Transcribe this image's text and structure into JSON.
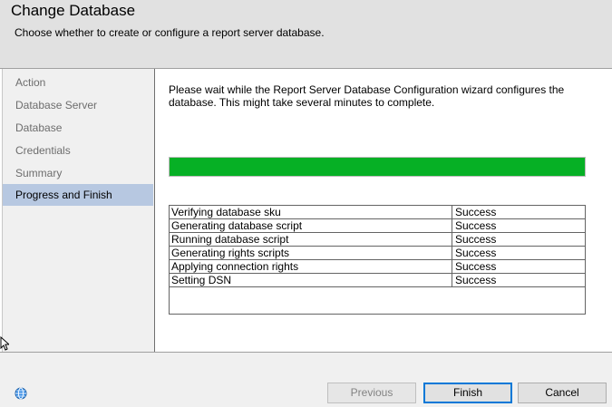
{
  "header": {
    "title": "Change Database",
    "subtitle": "Choose whether to create or configure a report server database."
  },
  "nav": {
    "items": [
      {
        "label": "Action",
        "selected": false
      },
      {
        "label": "Database Server",
        "selected": false
      },
      {
        "label": "Database",
        "selected": false
      },
      {
        "label": "Credentials",
        "selected": false
      },
      {
        "label": "Summary",
        "selected": false
      },
      {
        "label": "Progress and Finish",
        "selected": true
      }
    ]
  },
  "main": {
    "message": "Please wait while the Report Server Database Configuration wizard configures the database.  This might take several minutes to complete.",
    "progress": 1.0,
    "progress_color": "#06b025",
    "rows": [
      {
        "action": "Verifying database sku",
        "status": "Success"
      },
      {
        "action": "Generating database script",
        "status": "Success"
      },
      {
        "action": "Running database script",
        "status": "Success"
      },
      {
        "action": "Generating rights scripts",
        "status": "Success"
      },
      {
        "action": "Applying connection rights",
        "status": "Success"
      },
      {
        "action": "Setting DSN",
        "status": "Success"
      }
    ]
  },
  "footer": {
    "help_icon": "help-globe-icon",
    "previous_label": "Previous",
    "finish_label": "Finish",
    "cancel_label": "Cancel"
  }
}
